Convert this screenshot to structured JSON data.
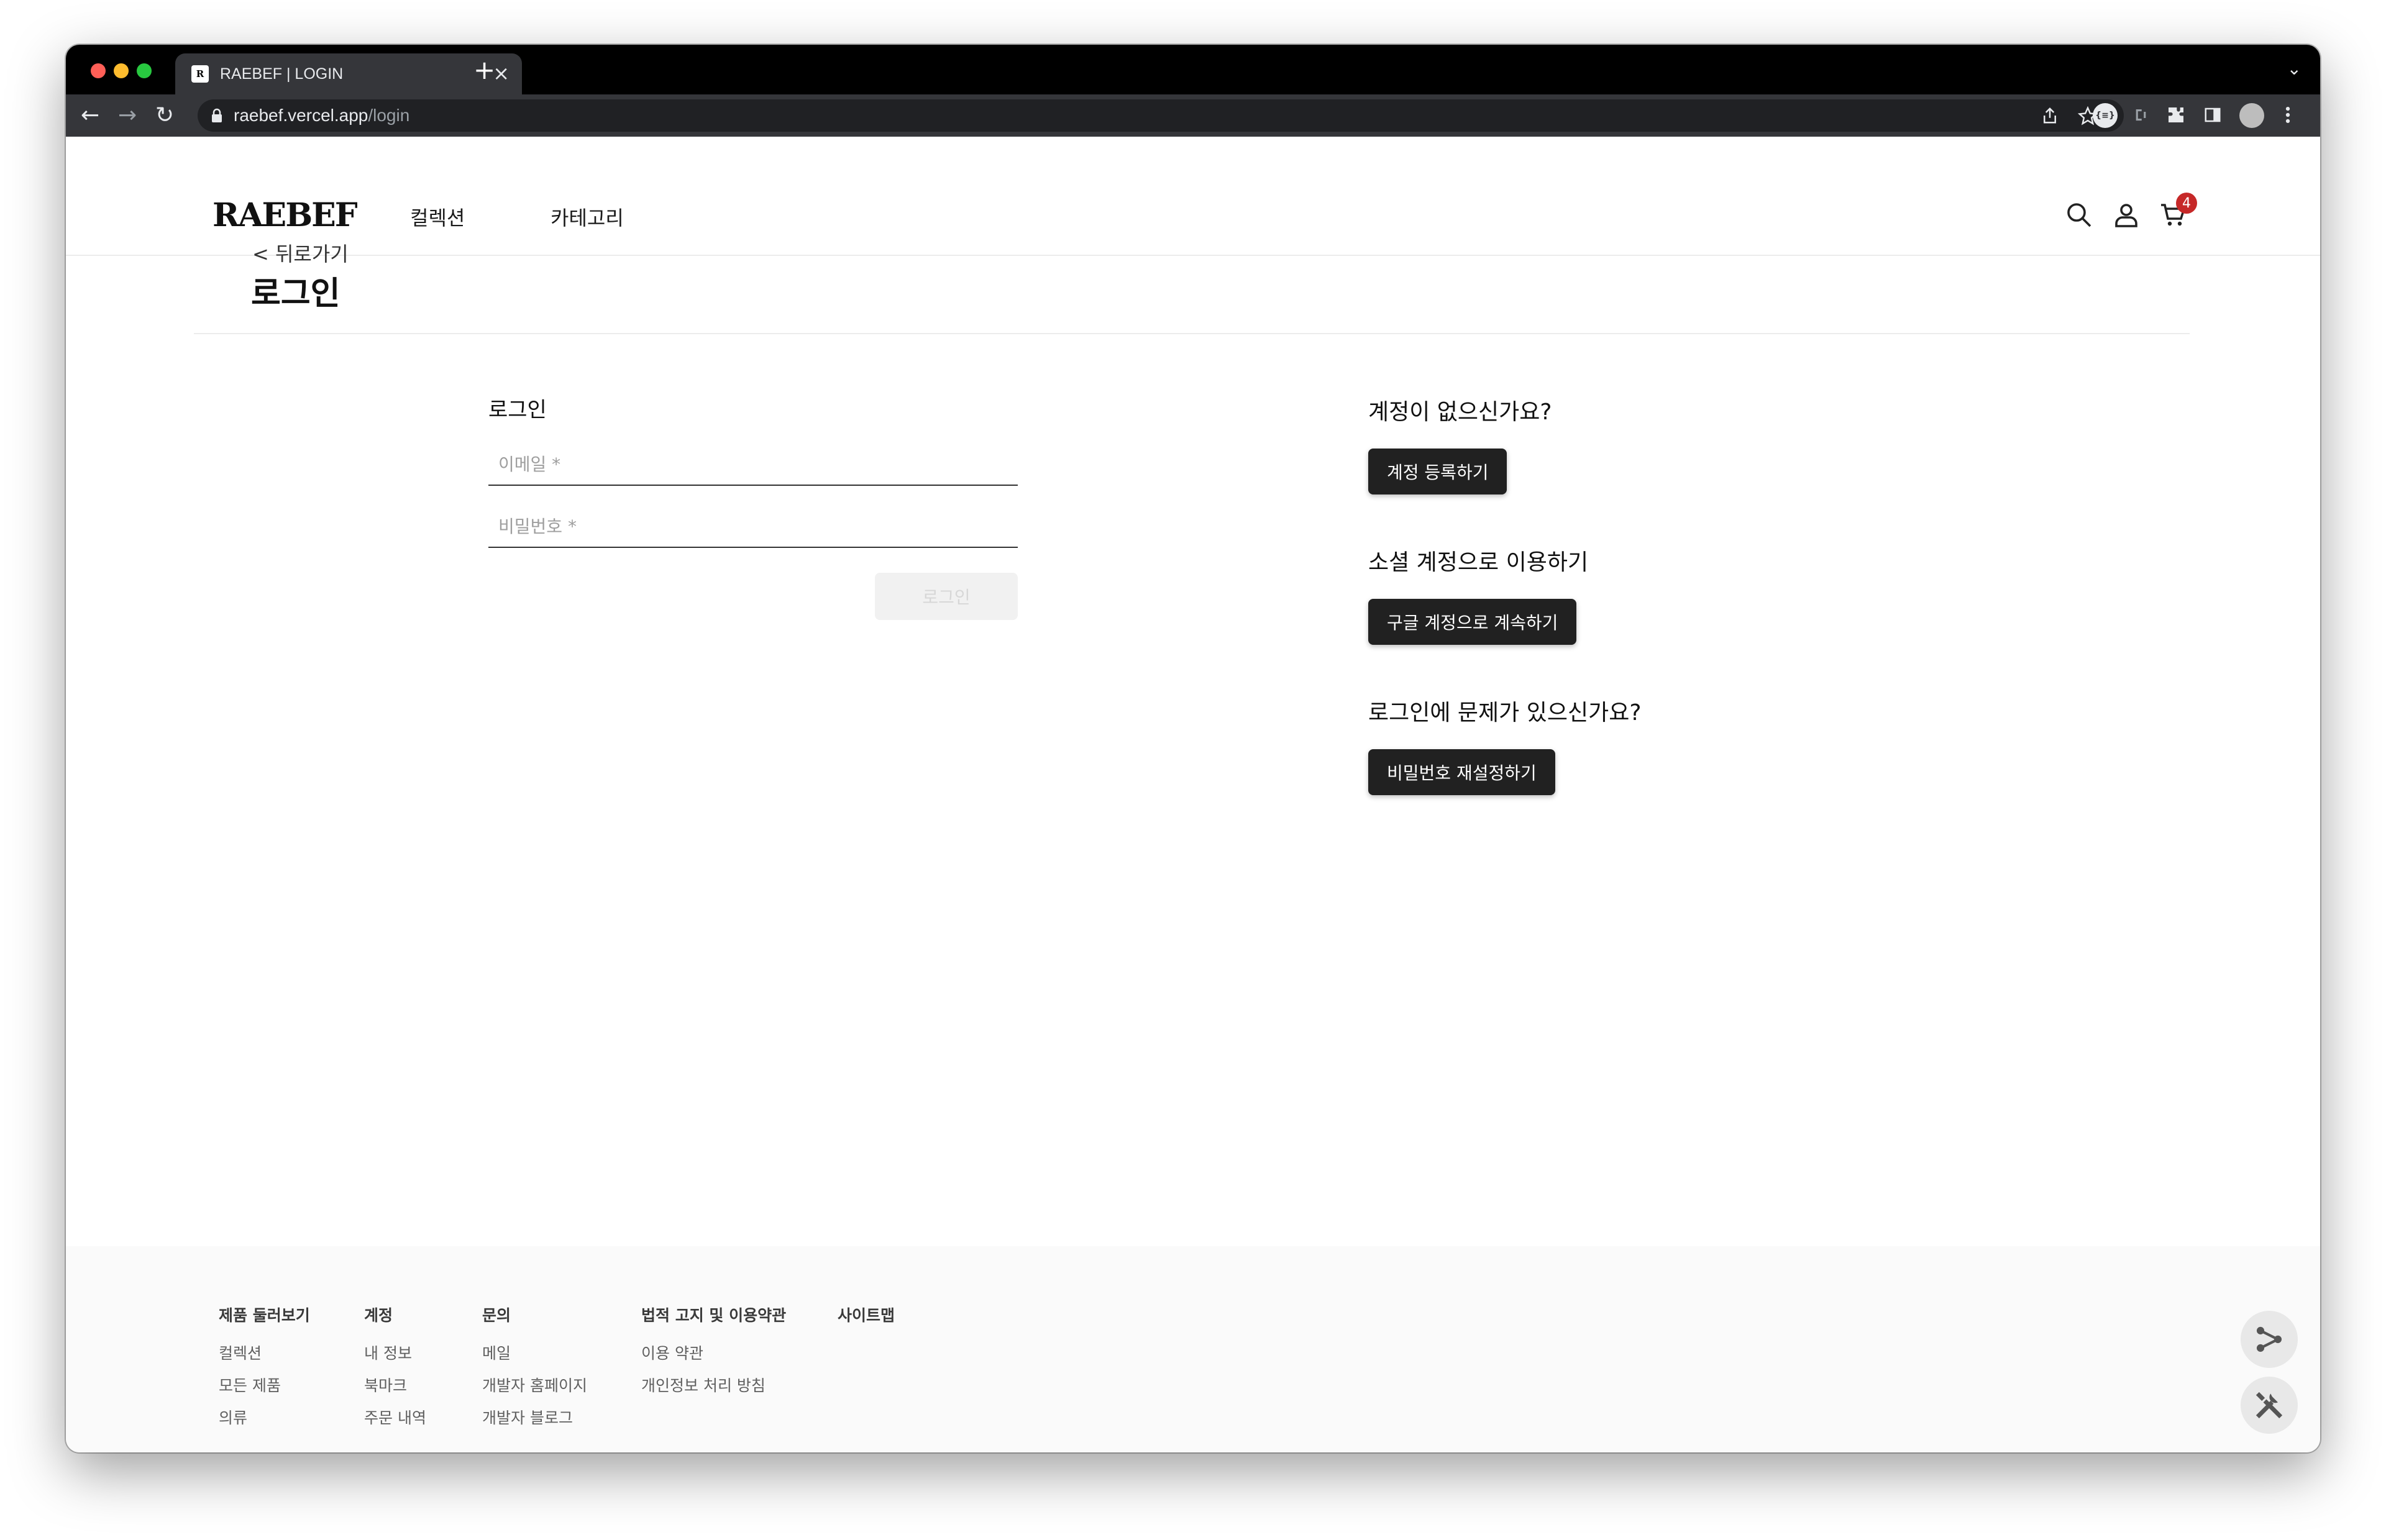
{
  "browser": {
    "tab_title": "RAEBEF | LOGIN",
    "favicon_text": "R",
    "close_glyph": "×",
    "new_tab_glyph": "+",
    "tab_menu_glyph": "⌄",
    "url_host": "raebef.vercel.app",
    "url_path": "/login",
    "nav_back": "←",
    "nav_forward": "→",
    "nav_reload": "↻",
    "ext_badge": "{≡}"
  },
  "header": {
    "logo": "RAEBEF",
    "nav": [
      "컬렉션",
      "카테고리"
    ],
    "cart_count": "4"
  },
  "page": {
    "back_link": "< 뒤로가기",
    "title": "로그인"
  },
  "login_form": {
    "title": "로그인",
    "email_placeholder": "이메일 *",
    "password_placeholder": "비밀번호 *",
    "submit_label": "로그인"
  },
  "right": {
    "no_account_heading": "계정이 없으신가요?",
    "register_button": "계정 등록하기",
    "social_heading": "소셜 계정으로 이용하기",
    "google_button": "구글 계정으로 계속하기",
    "trouble_heading": "로그인에 문제가 있으신가요?",
    "reset_button": "비밀번호 재설정하기"
  },
  "footer": {
    "columns": [
      {
        "heading": "제품 둘러보기",
        "items": [
          "컬렉션",
          "모든 제품",
          "의류"
        ]
      },
      {
        "heading": "계정",
        "items": [
          "내 정보",
          "북마크",
          "주문 내역"
        ]
      },
      {
        "heading": "문의",
        "items": [
          "메일",
          "개발자 홈페이지",
          "개발자 블로그"
        ]
      },
      {
        "heading": "법적 고지 및 이용약관",
        "items": [
          "이용 약관",
          "개인정보 처리 방침"
        ]
      },
      {
        "heading": "사이트맵",
        "items": []
      }
    ]
  },
  "colors": {
    "button_dark": "#212121",
    "badge_red": "#c62828",
    "browser_bg": "#35363a"
  }
}
